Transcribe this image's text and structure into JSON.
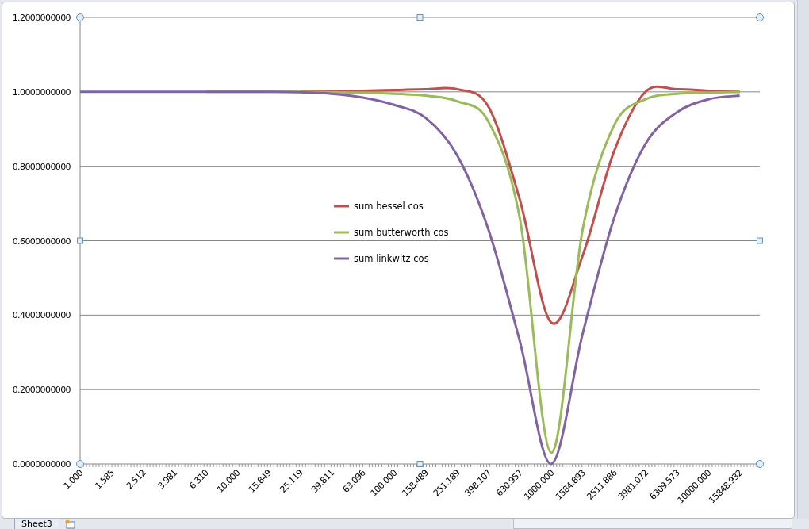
{
  "chart": {
    "chart_data": {
      "type": "line",
      "categories": [
        "1.000",
        "1.585",
        "2.512",
        "3.981",
        "6.310",
        "10.000",
        "15.849",
        "25.119",
        "39.811",
        "63.096",
        "100.000",
        "158.489",
        "251.189",
        "398.107",
        "630.957",
        "1000.000",
        "1584.893",
        "2511.886",
        "3981.072",
        "6309.573",
        "10000.000",
        "15848.932"
      ],
      "series": [
        {
          "name": "sum bessel cos",
          "color": "#c0504d",
          "values": [
            null,
            null,
            null,
            null,
            null,
            null,
            null,
            1.001,
            1.002,
            1.003,
            1.005,
            1.007,
            1.007,
            0.96,
            0.71,
            0.38,
            0.56,
            0.84,
            1.0,
            1.007,
            1.003,
            1.0
          ]
        },
        {
          "name": "sum butterworth cos",
          "color": "#9bbb59",
          "values": [
            null,
            null,
            null,
            null,
            1,
            1,
            1,
            1,
            0.999,
            0.998,
            0.995,
            0.99,
            0.975,
            0.92,
            0.66,
            0.03,
            0.63,
            0.91,
            0.98,
            0.995,
            0.998,
            1.0
          ]
        },
        {
          "name": "sum linkwitz cos",
          "color": "#8064a2",
          "values": [
            1,
            1,
            1,
            1,
            1,
            1,
            1,
            0.999,
            0.995,
            0.985,
            0.965,
            0.93,
            0.83,
            0.63,
            0.33,
            0.0,
            0.35,
            0.66,
            0.86,
            0.945,
            0.98,
            0.99
          ]
        }
      ],
      "ylim": [
        0,
        1.2
      ],
      "grid": true,
      "legend": true,
      "yticks": [
        {
          "value": 0,
          "label": "0.0000000000"
        },
        {
          "value": 0.2,
          "label": "0.2000000000"
        },
        {
          "value": 0.4,
          "label": "0.4000000000"
        },
        {
          "value": 0.6,
          "label": "0.6000000000"
        },
        {
          "value": 0.8,
          "label": "0.8000000000"
        },
        {
          "value": 1,
          "label": "1.0000000000"
        },
        {
          "value": 1.2,
          "label": "1.2000000000"
        }
      ]
    }
  },
  "sheet_tabs": [
    {
      "label": "Sheet3",
      "selected": false
    }
  ]
}
